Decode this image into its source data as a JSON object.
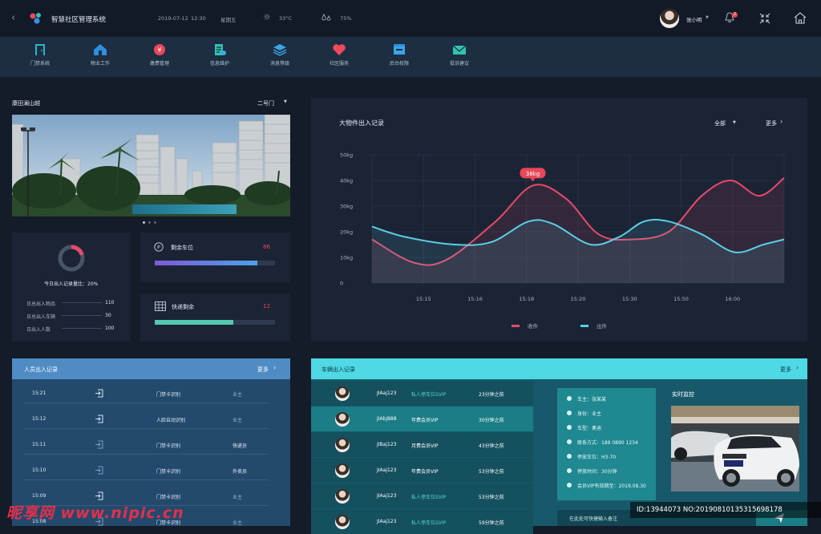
{
  "app": {
    "title": "智慧社区管理系统",
    "back_icon": "chevron-left-icon"
  },
  "topbar": {
    "date": "2019-07-12",
    "time": "12:30",
    "weekday": "星期五",
    "temperature": "33°C",
    "humidity": "75%",
    "user_name": "张小明",
    "notification_count": "2"
  },
  "nav": [
    {
      "label": "门禁系统",
      "icon": "door-icon",
      "color": "#2fb5c9"
    },
    {
      "label": "物业工作",
      "icon": "house-icon",
      "color": "#2f8ee0"
    },
    {
      "label": "缴费管理",
      "icon": "yen-coin-icon",
      "color": "#e9475a"
    },
    {
      "label": "信息维护",
      "icon": "document-edit-icon",
      "color": "#31c2b2"
    },
    {
      "label": "消息等级",
      "icon": "layers-icon",
      "color": "#3aa6e8"
    },
    {
      "label": "社区服务",
      "icon": "heart-icon",
      "color": "#ef4a5c"
    },
    {
      "label": "后台权限",
      "icon": "window-lock-icon",
      "color": "#3aa6e8"
    },
    {
      "label": "投诉建议",
      "icon": "mail-icon",
      "color": "#31c2b2"
    }
  ],
  "community": {
    "name": "康田澜山越",
    "gate": "二号门"
  },
  "ratio": {
    "label": "今日出入记录量比：20%",
    "percent": 20
  },
  "stats": [
    {
      "label": "日总出入物品",
      "value": "110"
    },
    {
      "label": "日总出入车辆",
      "value": "30"
    },
    {
      "label": "日出入人数",
      "value": "100"
    }
  ],
  "parking": {
    "label": "剩余车位",
    "value": "86",
    "fill": 0.85,
    "color": "#7d5bd6",
    "icon": "parking-icon"
  },
  "express": {
    "label": "快递剩余",
    "value": "12",
    "fill": 0.65,
    "color": "#54c8b0",
    "icon": "grid-box-icon"
  },
  "chart_data": {
    "type": "line",
    "title": "大物件出入记录",
    "filter": "全部",
    "more": "更多",
    "x": [
      "15:15",
      "15:16",
      "15:18",
      "15:20",
      "15:30",
      "15:50",
      "16:00"
    ],
    "ylim": [
      0,
      50
    ],
    "yticks": [
      "0",
      "10kg",
      "20kg",
      "30kg",
      "40kg",
      "50kg"
    ],
    "grid": true,
    "legend_placement": "bottom",
    "highlight": {
      "label": "38kg"
    },
    "series": [
      {
        "name": "收件",
        "color": "#e84a6a",
        "points": [
          [
            0,
            17
          ],
          [
            0.1,
            8
          ],
          [
            0.18,
            9
          ],
          [
            0.3,
            24
          ],
          [
            0.39,
            38
          ],
          [
            0.47,
            33
          ],
          [
            0.55,
            19
          ],
          [
            0.63,
            17
          ],
          [
            0.72,
            20
          ],
          [
            0.8,
            34
          ],
          [
            0.87,
            40
          ],
          [
            0.94,
            34
          ],
          [
            1.0,
            41
          ]
        ]
      },
      {
        "name": "出件",
        "color": "#5ad0e8",
        "points": [
          [
            0,
            22
          ],
          [
            0.08,
            18
          ],
          [
            0.2,
            15
          ],
          [
            0.29,
            16
          ],
          [
            0.38,
            24
          ],
          [
            0.44,
            23
          ],
          [
            0.53,
            15
          ],
          [
            0.6,
            18
          ],
          [
            0.66,
            24
          ],
          [
            0.72,
            24
          ],
          [
            0.8,
            19
          ],
          [
            0.88,
            12
          ],
          [
            0.95,
            15
          ],
          [
            1.0,
            17
          ]
        ]
      }
    ]
  },
  "people": {
    "title": "人员出入记录",
    "more": "更多",
    "rows": [
      {
        "time": "15:21",
        "dir": "in",
        "method": "门禁卡识别",
        "role": "业主",
        "role_dim": true
      },
      {
        "time": "15:12",
        "dir": "in",
        "method": "人脸自动识别",
        "role": "业主",
        "role_dim": true
      },
      {
        "time": "15:11",
        "dir": "out",
        "method": "门禁卡识别",
        "role": "快递员",
        "role_dim": false
      },
      {
        "time": "15:10",
        "dir": "out",
        "method": "门禁卡识别",
        "role": "外卖员",
        "role_dim": false
      },
      {
        "time": "15:09",
        "dir": "in",
        "method": "门禁卡识别",
        "role": "业主",
        "role_dim": true
      },
      {
        "time": "15:08",
        "dir": "out",
        "method": "门禁卡识别",
        "role": "业主",
        "role_dim": true
      }
    ]
  },
  "vehicles": {
    "title": "车辆出入记录",
    "more": "更多",
    "rows": [
      {
        "plate": "JIAaj123",
        "type": "私人停车位SVIP",
        "type_hl": true,
        "ago": "23分钟之前"
      },
      {
        "plate": "JIAbj888",
        "type": "年费会员VIP",
        "type_hl": false,
        "ago": "30分钟之前"
      },
      {
        "plate": "JIBaj123",
        "type": "月费会员VIP",
        "type_hl": false,
        "ago": "43分钟之前"
      },
      {
        "plate": "JIAaj123",
        "type": "年费会员VIP",
        "type_hl": false,
        "ago": "53分钟之前"
      },
      {
        "plate": "JIAaj123",
        "type": "私人停车位SVIP",
        "type_hl": true,
        "ago": "53分钟之前"
      },
      {
        "plate": "JIAaj123",
        "type": "私人停车位SVIP",
        "type_hl": true,
        "ago": "59分钟之前"
      }
    ]
  },
  "detail": {
    "items": [
      {
        "icon": "user-icon",
        "text": "车主：张某某"
      },
      {
        "icon": "id-icon",
        "text": "身份：业主"
      },
      {
        "icon": "car-icon",
        "text": "车型：奥迪"
      },
      {
        "icon": "phone-icon",
        "text": "联系方式：189 0890 1234"
      },
      {
        "icon": "parking-icon",
        "text": "停放车位：H3-70"
      },
      {
        "icon": "clock-icon",
        "text": "停放时间：30分钟"
      },
      {
        "icon": "vip-icon",
        "text": "会员VIP有效期至：2019.08.30"
      }
    ],
    "monitor_title": "实时监控",
    "input_placeholder": "在此处可快捷输入备注"
  },
  "watermark": {
    "brand": "昵享网 www.nipic.cn",
    "id": "ID:13944073 NO:20190810135315698178"
  }
}
